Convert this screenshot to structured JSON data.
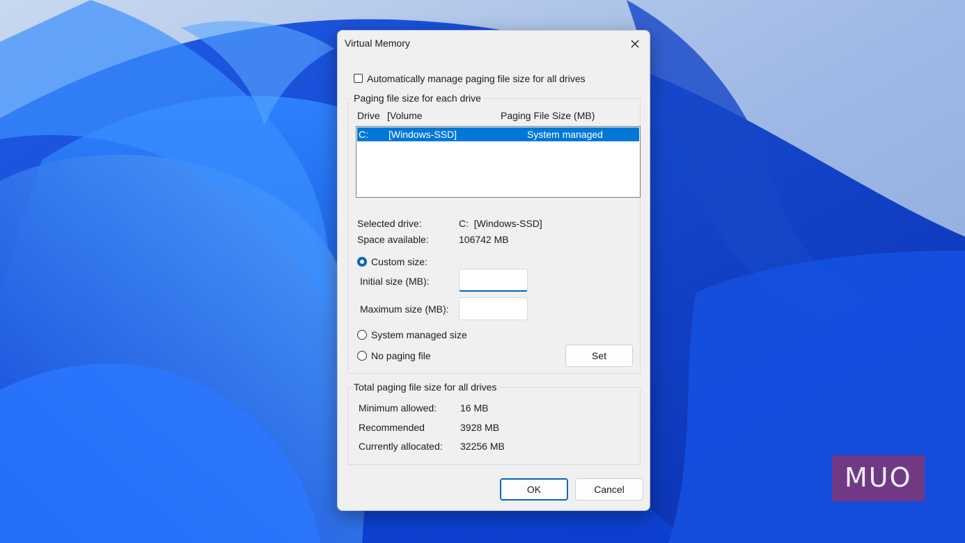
{
  "dialog": {
    "title": "Virtual Memory",
    "close_icon": "close-icon",
    "auto_manage_label": "Automatically manage paging file size for all drives",
    "auto_manage_checked": false
  },
  "drives_group": {
    "legend": "Paging file size for each drive",
    "header_drive": "Drive",
    "header_volume": "[Volume",
    "header_size": "Paging File Size (MB)",
    "rows": [
      {
        "drive": "C:",
        "volume": "[Windows-SSD]",
        "size": "System managed"
      }
    ],
    "selected_drive_label": "Selected drive:",
    "selected_drive_value": "C:  [Windows-SSD]",
    "space_available_label": "Space available:",
    "space_available_value": "106742 MB",
    "custom_size_label": "Custom size:",
    "initial_size_label": "Initial size (MB):",
    "initial_size_value": "",
    "maximum_size_label": "Maximum size (MB):",
    "maximum_size_value": "",
    "system_managed_label": "System managed size",
    "no_paging_label": "No paging file",
    "selected_option": "Custom size",
    "set_label": "Set"
  },
  "total_group": {
    "legend": "Total paging file size for all drives",
    "minimum_label": "Minimum allowed:",
    "minimum_value": "16 MB",
    "recommended_label": "Recommended",
    "recommended_value": "3928 MB",
    "allocated_label": "Currently allocated:",
    "allocated_value": "32256 MB"
  },
  "buttons": {
    "ok_label": "OK",
    "cancel_label": "Cancel"
  },
  "watermark": {
    "text": "MUO"
  },
  "colors": {
    "accent": "#0067c0",
    "selection": "#0078d7",
    "dialog_bg": "#f0f0f0",
    "wallpaper_primary": "#1f5fe0",
    "watermark": "#be283c"
  }
}
